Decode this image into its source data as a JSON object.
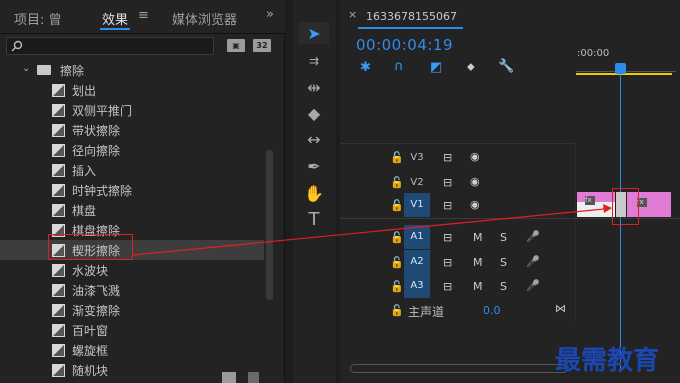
{
  "left_panel": {
    "tabs": [
      {
        "label": "项目: 曾"
      },
      {
        "label": "效果"
      },
      {
        "label": "媒体浏览器"
      }
    ],
    "menu_icon": "≡",
    "overflow_icon": "»",
    "badges": [
      "32"
    ],
    "folder": "擦除",
    "items": [
      "划出",
      "双侧平推门",
      "带状擦除",
      "径向擦除",
      "插入",
      "时钟式擦除",
      "棋盘",
      "棋盘擦除",
      "楔形擦除",
      "水波块",
      "油漆飞溅",
      "渐变擦除",
      "百叶窗",
      "螺旋框",
      "随机块"
    ],
    "selected_index": 8
  },
  "timeline": {
    "title": "1633678155067",
    "timecode": "00:00:04:19",
    "ruler_label": ":00:00",
    "tracks": [
      {
        "name": "V3",
        "kind": "video"
      },
      {
        "name": "V2",
        "kind": "video"
      },
      {
        "name": "V1",
        "kind": "video",
        "target": true
      },
      {
        "name": "A1",
        "kind": "audio",
        "target": true
      },
      {
        "name": "A2",
        "kind": "audio",
        "target": true
      },
      {
        "name": "A3",
        "kind": "audio",
        "target": true
      }
    ],
    "master_label": "主声道",
    "master_value": "0.0",
    "m_label": "M",
    "s_label": "S"
  },
  "watermark": "最需教育",
  "colors": {
    "accent": "#2d8ceb",
    "clip": "#e07bd6",
    "annotation": "#e02020",
    "ruler_bar": "#e8d000"
  }
}
